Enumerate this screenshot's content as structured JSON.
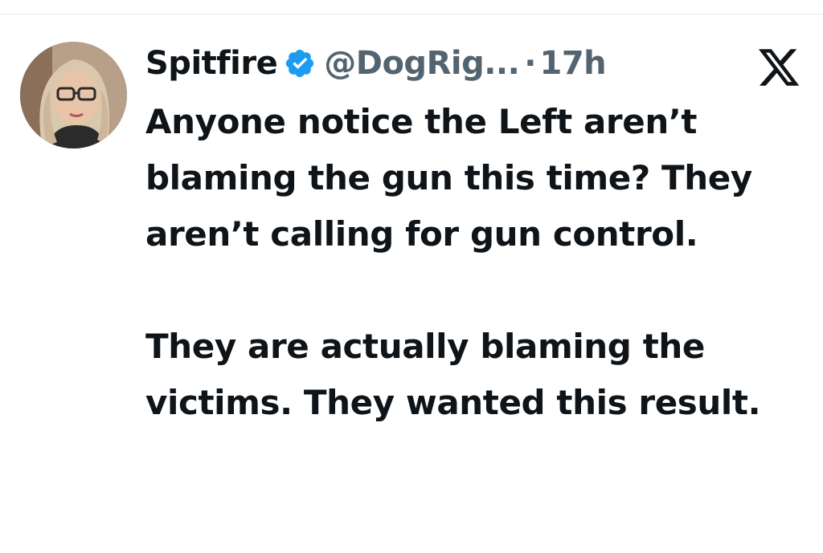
{
  "tweet": {
    "author": {
      "display_name": "Spitfire",
      "handle": "@DogRig...",
      "verified_icon": "verified-badge-icon",
      "avatar_icon": "profile-avatar"
    },
    "separator": "·",
    "timestamp": "17h",
    "platform_icon": "x-logo-icon",
    "paragraph_1": "Anyone notice the Left aren’t blaming the gun this time? They aren’t calling for gun control.",
    "paragraph_2": "They are actually blaming the victims. They wanted this result."
  },
  "colors": {
    "text_primary": "#0f1419",
    "text_secondary": "#536471",
    "verified_blue": "#1d9bf0",
    "divider": "#e6e9eb",
    "background": "#ffffff"
  }
}
